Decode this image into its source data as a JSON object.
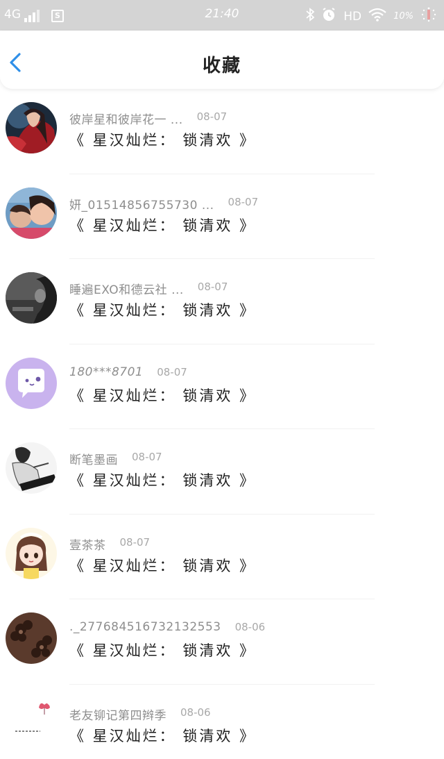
{
  "status_bar": {
    "network": "4G",
    "time": "21:40",
    "hd": "HD",
    "battery": "10%"
  },
  "header": {
    "title": "收藏"
  },
  "colors": {
    "accent": "#2f8fe8",
    "status_bar_bg": "#d4d4d4"
  },
  "items": [
    {
      "name": "彼岸星和彼岸花一 ...",
      "date": "08-07",
      "title": "《 星汉灿烂： 锁清欢 》",
      "avatar_icon": "fantasy-girl-avatar"
    },
    {
      "name": "妍_01514856755730 ...",
      "date": "08-07",
      "title": "《 星汉灿烂： 锁清欢 》",
      "avatar_icon": "two-girls-photo-avatar"
    },
    {
      "name": "睡遍EXO和德云社 ...",
      "date": "08-07",
      "title": "《 星汉灿烂： 锁清欢 》",
      "avatar_icon": "dark-photo-avatar"
    },
    {
      "name": "180***8701",
      "date": "08-07",
      "title": "《 星汉灿烂： 锁清欢 》",
      "avatar_icon": "chat-bubble-default-avatar"
    },
    {
      "name": "断笔墨画",
      "date": "08-07",
      "title": "《 星汉灿烂： 锁清欢 》",
      "avatar_icon": "sketch-person-avatar"
    },
    {
      "name": "壹茶茶",
      "date": "08-07",
      "title": "《 星汉灿烂： 锁清欢 》",
      "avatar_icon": "cartoon-maid-girl-avatar"
    },
    {
      "name": "._277684516732132553",
      "date": "08-06",
      "title": "《 星汉灿烂： 锁清欢 》",
      "avatar_icon": "brown-flower-pattern-avatar"
    },
    {
      "name": "老友铆记第四辫季",
      "date": "08-06",
      "title": "《 星汉灿烂： 锁清欢 》",
      "avatar_icon": "butterfly-sketch-avatar"
    }
  ]
}
